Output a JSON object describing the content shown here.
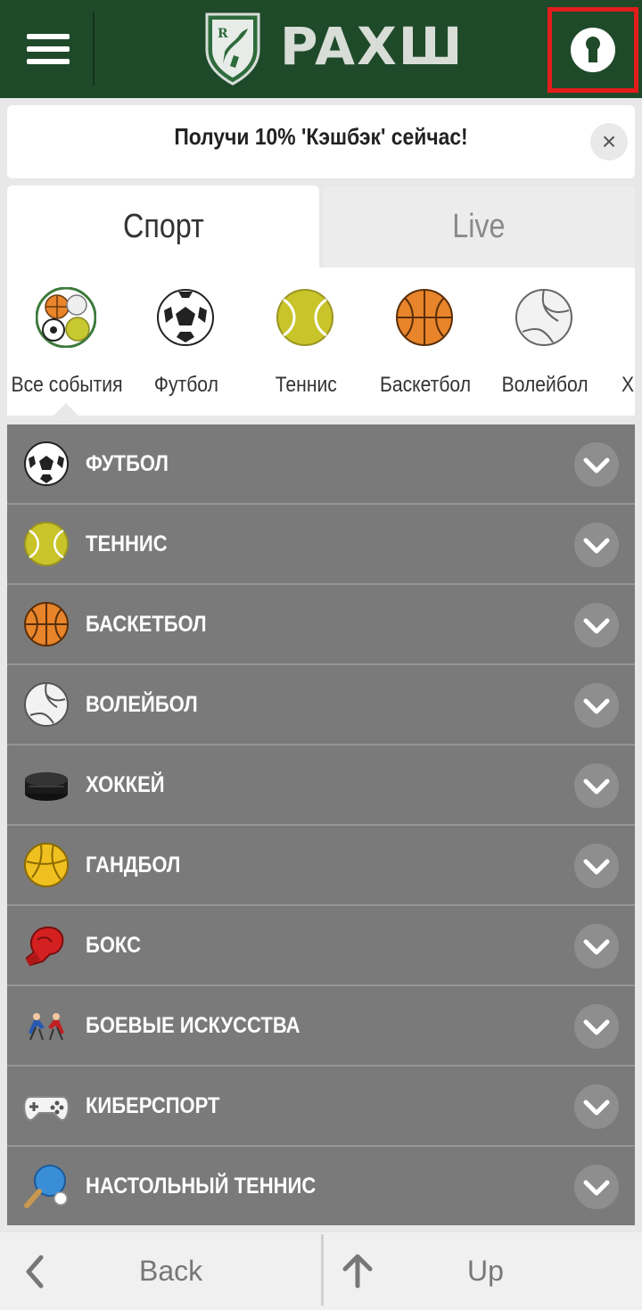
{
  "header": {
    "logo_text": "PAXШ",
    "logo_shield_letter": "R",
    "menu_icon": "hamburger-menu-icon",
    "login_icon": "keyhole-icon"
  },
  "promo": {
    "text": "Получи 10% 'Кэшбэк' сейчас!",
    "close_glyph": "×"
  },
  "tabs": [
    {
      "label": "Спорт",
      "active": true
    },
    {
      "label": "Live",
      "active": false
    }
  ],
  "sport_strip": [
    {
      "label": "Все события",
      "icon": "all-events-icon"
    },
    {
      "label": "Футбол",
      "icon": "football-icon"
    },
    {
      "label": "Теннис",
      "icon": "tennis-icon"
    },
    {
      "label": "Баскетбол",
      "icon": "basketball-icon"
    },
    {
      "label": "Волейбол",
      "icon": "volleyball-icon"
    },
    {
      "label": "Х",
      "icon": "hockey-icon"
    }
  ],
  "sport_list": [
    {
      "label": "ФУТБОЛ",
      "icon": "football-icon"
    },
    {
      "label": "ТЕННИС",
      "icon": "tennis-icon"
    },
    {
      "label": "БАСКЕТБОЛ",
      "icon": "basketball-icon"
    },
    {
      "label": "ВОЛЕЙБОЛ",
      "icon": "volleyball-icon"
    },
    {
      "label": "ХОККЕЙ",
      "icon": "hockey-puck-icon"
    },
    {
      "label": "ГАНДБОЛ",
      "icon": "handball-icon"
    },
    {
      "label": "БОКС",
      "icon": "boxing-glove-icon"
    },
    {
      "label": "БОЕВЫЕ ИСКУССТВА",
      "icon": "martial-arts-icon"
    },
    {
      "label": "КИБЕРСПОРТ",
      "icon": "gamepad-icon"
    },
    {
      "label": "НАСТОЛЬНЫЙ ТЕННИС",
      "icon": "table-tennis-icon"
    }
  ],
  "bottom_bar": {
    "back_label": "Back",
    "up_label": "Up"
  },
  "colors": {
    "header_bg": "#1f4a2a",
    "list_bg": "#7a7a7a",
    "highlight_border": "#e31c1c"
  }
}
